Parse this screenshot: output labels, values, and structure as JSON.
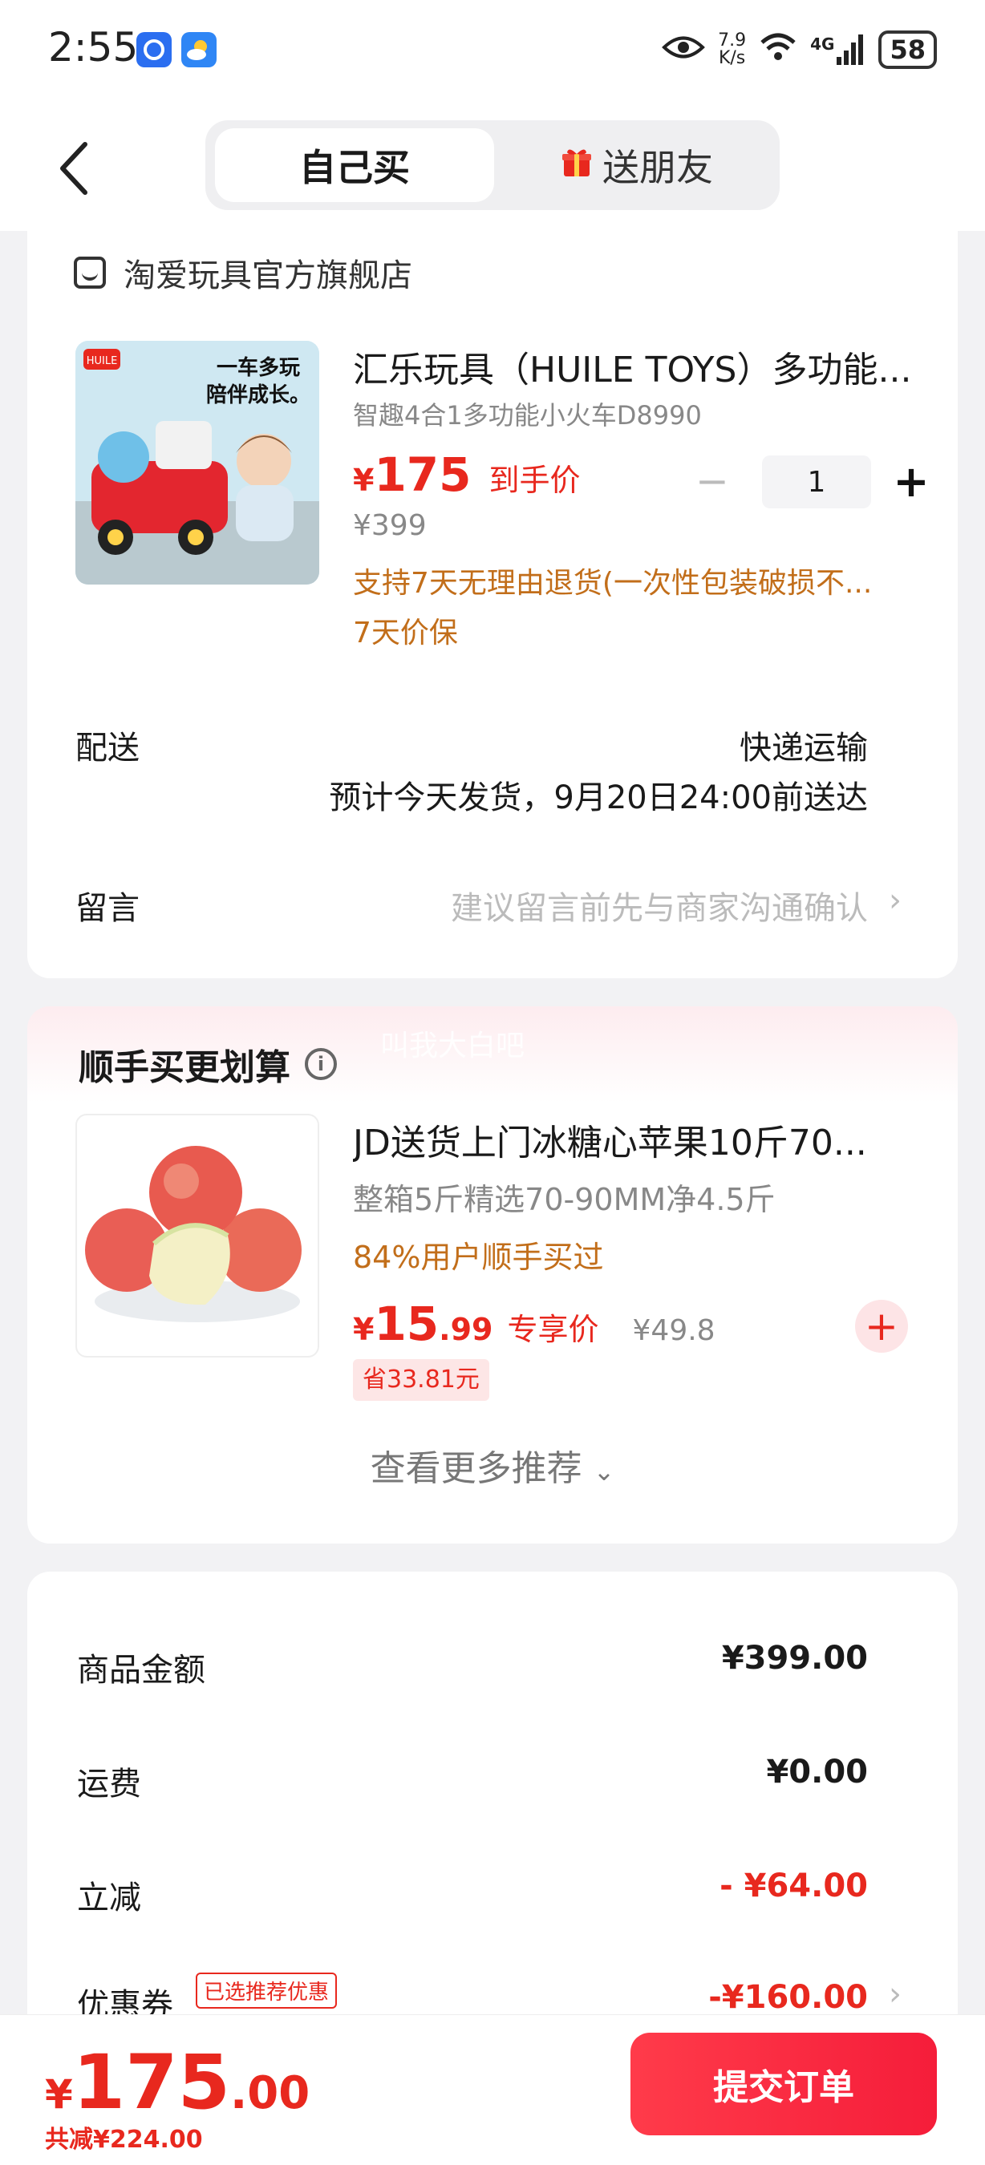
{
  "status_bar": {
    "time": "2:55",
    "net_speed_value": "7.9",
    "net_speed_unit": "K/s",
    "network": "4G",
    "battery": "58"
  },
  "header": {
    "tabs": [
      {
        "label": "自己买",
        "active": true
      },
      {
        "label": "送朋友",
        "active": false
      }
    ]
  },
  "store": {
    "name": "淘爱玩具官方旗舰店",
    "product": {
      "image_text": "一车多玩 陪伴成长。",
      "image_brand": "HUILE",
      "title": "汇乐玩具（HUILE TOYS）多功能...",
      "spec": "智趣4合1多功能小火车D8990",
      "price_currency": "¥",
      "price": "175",
      "price_tag": "到手价",
      "original_price": "¥399",
      "service_return": "支持7天无理由退货(一次性包装破损不...",
      "service_price": "7天价保",
      "quantity": "1"
    },
    "delivery": {
      "label": "配送",
      "method": "快递运输",
      "eta": "预计今天发货，9月20日24:00前送达"
    },
    "message": {
      "label": "留言",
      "placeholder": "建议留言前先与商家沟通确认"
    }
  },
  "recommend": {
    "title": "顺手买更划算",
    "watermark": "叫我大白吧",
    "item": {
      "name": "JD送货上门冰糖心苹果10斤70...",
      "spec": "整箱5斤精选70-90MM净4.5斤",
      "bought": "84%用户顺手买过",
      "price_currency": "¥",
      "price_int": "15",
      "price_dec": ".99",
      "price_tag": "专享价",
      "original_price": "¥49.8",
      "save": "省33.81元"
    },
    "more_label": "查看更多推荐"
  },
  "summary": {
    "rows": [
      {
        "label": "商品金额",
        "value": "¥399.00"
      },
      {
        "label": "运费",
        "value": "¥0.00"
      },
      {
        "label": "立减",
        "value": "- ¥64.00"
      },
      {
        "label": "优惠券",
        "value": "-¥160.00"
      }
    ],
    "coupon_badge": "已选推荐优惠"
  },
  "bottom_bar": {
    "total_currency": "¥",
    "total_int": "175",
    "total_dec": ".00",
    "total_save": "共减¥224.00",
    "submit_label": "提交订单"
  },
  "colors": {
    "accent_red": "#e8281e",
    "service_orange": "#c26e1a",
    "page_bg": "#f2f2f4"
  }
}
